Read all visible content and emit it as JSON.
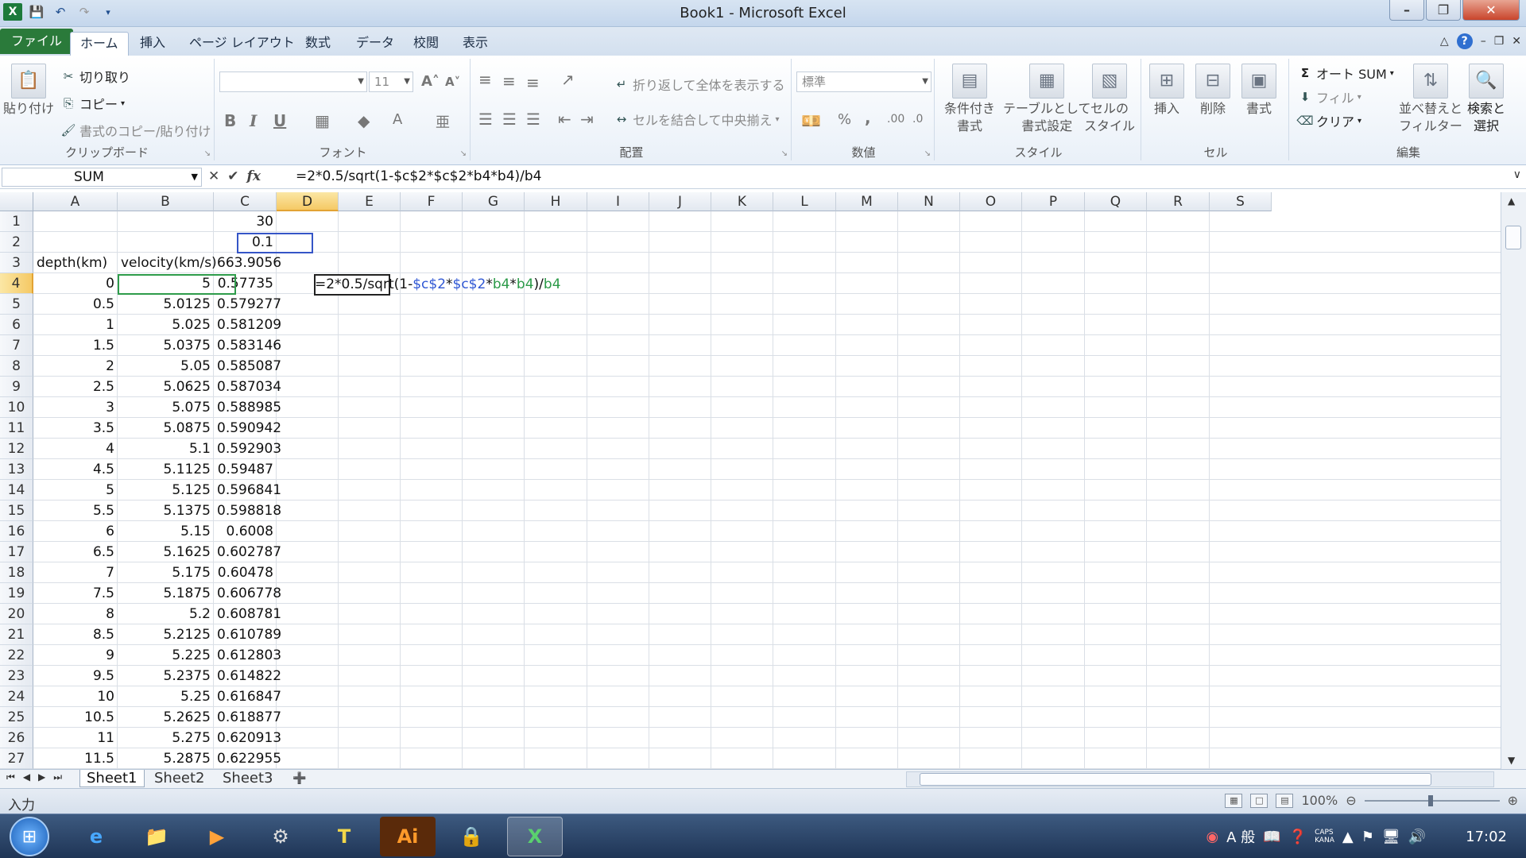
{
  "window": {
    "title": "Book1 - Microsoft Excel"
  },
  "tabs": [
    "ファイル",
    "ホーム",
    "挿入",
    "ページ レイアウト",
    "数式",
    "データ",
    "校閲",
    "表示"
  ],
  "active_tab": "ホーム",
  "ribbon": {
    "clipboard": {
      "label": "クリップボード",
      "paste": "貼り付け",
      "cut": "切り取り",
      "copy": "コピー",
      "format_painter": "書式のコピー/貼り付け"
    },
    "font": {
      "label": "フォント",
      "font_name": "",
      "font_size": "11",
      "bold": "B",
      "italic": "I",
      "underline": "U"
    },
    "alignment": {
      "label": "配置",
      "wrap_text": "折り返して全体を表示する",
      "merge_center": "セルを結合して中央揃え"
    },
    "number": {
      "label": "数値",
      "format": "標準",
      "percent": "%",
      "comma": ","
    },
    "styles": {
      "label": "スタイル",
      "conditional": [
        "条件付き",
        "書式"
      ],
      "table": [
        "テーブルとして",
        "書式設定"
      ],
      "cell_styles": [
        "セルの",
        "スタイル"
      ]
    },
    "cells": {
      "label": "セル",
      "insert": "挿入",
      "delete": "削除",
      "format": "書式"
    },
    "editing": {
      "label": "編集",
      "autosum": "オート SUM",
      "fill": "フィル",
      "clear": "クリア",
      "sort": [
        "並べ替えと",
        "フィルター"
      ],
      "find": [
        "検索と",
        "選択"
      ]
    }
  },
  "formula_bar": {
    "name_box": "SUM",
    "formula": "=2*0.5/sqrt(1-$c$2*$c$2*b4*b4)/b4"
  },
  "columns": [
    "A",
    "B",
    "C",
    "D",
    "E",
    "F",
    "G",
    "H",
    "I",
    "J",
    "K",
    "L",
    "M",
    "N",
    "O",
    "P",
    "Q",
    "R",
    "S"
  ],
  "selected_column": "D",
  "selected_row": "4",
  "rows": [
    {
      "n": "1",
      "a": "",
      "b": "",
      "c": "30"
    },
    {
      "n": "2",
      "a": "",
      "b": "",
      "c": "0.1"
    },
    {
      "n": "3",
      "a": "depth(km)",
      "b": "velocity(km/s)",
      "c": "663.9056"
    },
    {
      "n": "4",
      "a": "0",
      "b": "5",
      "c": "0.57735"
    },
    {
      "n": "5",
      "a": "0.5",
      "b": "5.0125",
      "c": "0.579277"
    },
    {
      "n": "6",
      "a": "1",
      "b": "5.025",
      "c": "0.581209"
    },
    {
      "n": "7",
      "a": "1.5",
      "b": "5.0375",
      "c": "0.583146"
    },
    {
      "n": "8",
      "a": "2",
      "b": "5.05",
      "c": "0.585087"
    },
    {
      "n": "9",
      "a": "2.5",
      "b": "5.0625",
      "c": "0.587034"
    },
    {
      "n": "10",
      "a": "3",
      "b": "5.075",
      "c": "0.588985"
    },
    {
      "n": "11",
      "a": "3.5",
      "b": "5.0875",
      "c": "0.590942"
    },
    {
      "n": "12",
      "a": "4",
      "b": "5.1",
      "c": "0.592903"
    },
    {
      "n": "13",
      "a": "4.5",
      "b": "5.1125",
      "c": "0.59487"
    },
    {
      "n": "14",
      "a": "5",
      "b": "5.125",
      "c": "0.596841"
    },
    {
      "n": "15",
      "a": "5.5",
      "b": "5.1375",
      "c": "0.598818"
    },
    {
      "n": "16",
      "a": "6",
      "b": "5.15",
      "c": "0.6008"
    },
    {
      "n": "17",
      "a": "6.5",
      "b": "5.1625",
      "c": "0.602787"
    },
    {
      "n": "18",
      "a": "7",
      "b": "5.175",
      "c": "0.60478"
    },
    {
      "n": "19",
      "a": "7.5",
      "b": "5.1875",
      "c": "0.606778"
    },
    {
      "n": "20",
      "a": "8",
      "b": "5.2",
      "c": "0.608781"
    },
    {
      "n": "21",
      "a": "8.5",
      "b": "5.2125",
      "c": "0.610789"
    },
    {
      "n": "22",
      "a": "9",
      "b": "5.225",
      "c": "0.612803"
    },
    {
      "n": "23",
      "a": "9.5",
      "b": "5.2375",
      "c": "0.614822"
    },
    {
      "n": "24",
      "a": "10",
      "b": "5.25",
      "c": "0.616847"
    },
    {
      "n": "25",
      "a": "10.5",
      "b": "5.2625",
      "c": "0.618877"
    },
    {
      "n": "26",
      "a": "11",
      "b": "5.275",
      "c": "0.620913"
    },
    {
      "n": "27",
      "a": "11.5",
      "b": "5.2875",
      "c": "0.622955"
    }
  ],
  "editing_cell": {
    "parts": [
      {
        "t": "=2*0.5/sqrt(1-",
        "c": "plain"
      },
      {
        "t": "$c$2",
        "c": "blue"
      },
      {
        "t": "*",
        "c": "plain"
      },
      {
        "t": "$c$2",
        "c": "blue"
      },
      {
        "t": "*",
        "c": "plain"
      },
      {
        "t": "b4",
        "c": "green"
      },
      {
        "t": "*",
        "c": "plain"
      },
      {
        "t": "b4",
        "c": "green"
      },
      {
        "t": ")/",
        "c": "plain"
      },
      {
        "t": "b4",
        "c": "green"
      }
    ]
  },
  "sheets": [
    "Sheet1",
    "Sheet2",
    "Sheet3"
  ],
  "active_sheet": "Sheet1",
  "status": {
    "mode": "入力",
    "zoom": "100%"
  },
  "taskbar": {
    "apps": [
      "ie",
      "explorer",
      "media-player",
      "scanner",
      "typing",
      "illustrator",
      "security",
      "excel"
    ],
    "tray_ime": "A 般",
    "caps": [
      "CAPS",
      "KANA"
    ],
    "clock": "17:02"
  },
  "colors": {
    "accent": "#2a7a3a",
    "ref_blue": "#2f57d4",
    "ref_green": "#2b9a48",
    "selection": "#f5c965"
  }
}
